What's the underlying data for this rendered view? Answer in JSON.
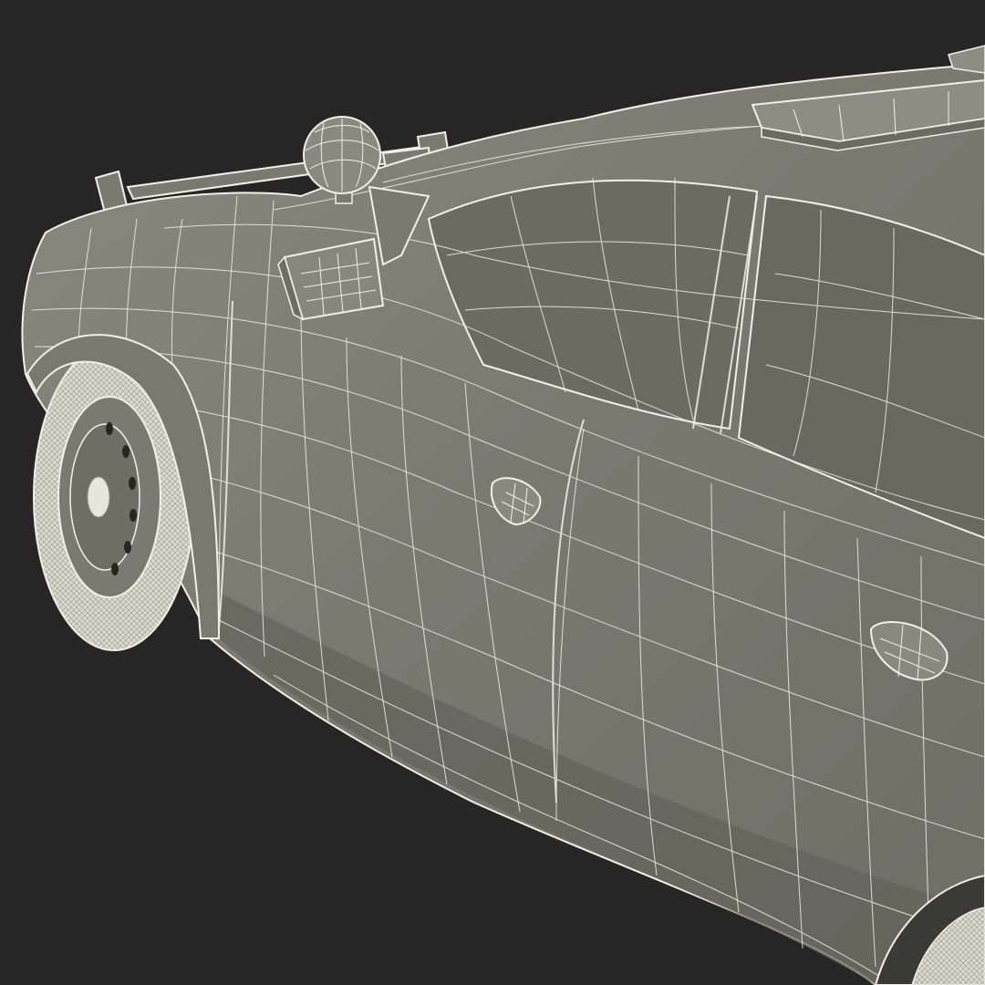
{
  "scene": {
    "subject": "wireframe-render",
    "colors": {
      "background": "#262626",
      "surface": "#7b7a70",
      "surface_shadow": "#5d5c54",
      "surface_light": "#8e8d83",
      "wire": "#f2f0e6",
      "tire": "#ece9de",
      "glass": "#6c6b62"
    },
    "icons": [
      "car-body-icon",
      "wheel-icon",
      "mirror-icon",
      "spotlight-icon",
      "light-bar-icon",
      "door-handle-icon"
    ]
  }
}
